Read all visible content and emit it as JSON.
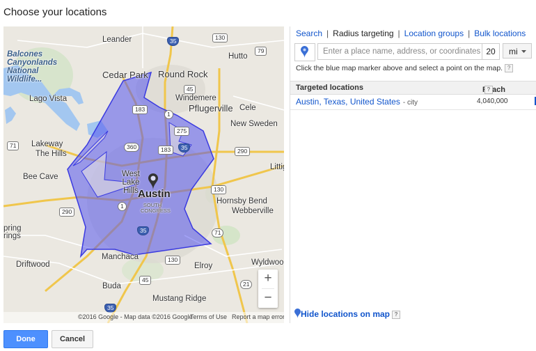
{
  "dialog": {
    "title": "Choose your locations"
  },
  "map": {
    "labels": {
      "leander": "Leander",
      "cedar_park": "Cedar Park",
      "round_rock": "Round Rock",
      "hutto": "Hutto",
      "balcones": "Balcones Canyonlands National Wildlife...",
      "lago_vista": "Lago Vista",
      "windemere": "Windemere",
      "pflugerville": "Pflugerville",
      "cele": "Cele",
      "new_sweden": "New Sweden",
      "lakeway": "Lakeway",
      "the_hills": "The Hills",
      "bee_cave": "Bee Cave",
      "west_lake_hills": "West Lake Hills",
      "austin": "Austin",
      "south_congress": "SOUTH CONGRESS",
      "littig": "Littig",
      "hornsby_bend": "Hornsby Bend",
      "webberville": "Webberville",
      "spring": "pring",
      "rings": "rings",
      "driftwood": "Driftwood",
      "manchaca": "Manchaca",
      "elroy": "Elroy",
      "wyldwood": "Wyldwood",
      "buda": "Buda",
      "mustang_ridge": "Mustang Ridge"
    },
    "shields": {
      "i35_north": "35",
      "us130_north": "130",
      "us79": "79",
      "us183_north": "183",
      "r1_north": "1",
      "us45_north": "45",
      "r275": "275",
      "us183_mid": "183",
      "i35_mid": "35",
      "r360": "360",
      "us290_east": "290",
      "r71_west": "71",
      "us290_west": "290",
      "r1_south": "1",
      "us130_mid": "130",
      "i35_south": "35",
      "r71_east": "71",
      "us45_south": "45",
      "r21": "21",
      "us130_south": "130",
      "i35_bottom": "35"
    },
    "zoom_in": "+",
    "zoom_out": "−",
    "footer": {
      "copyright": "©2016 Google - Map data ©2016 Google",
      "terms": "Terms of Use",
      "report": "Report a map error"
    },
    "selection_color": "#5555ee"
  },
  "panel": {
    "tabs": {
      "search": "Search",
      "radius": "Radius targeting",
      "groups": "Location groups",
      "bulk": "Bulk locations"
    },
    "separator": "|",
    "place_input": {
      "placeholder": "Enter a place name, address, or coordinates",
      "value": ""
    },
    "radius_value": "20",
    "unit": "mi",
    "hint": "Click the blue map marker above and select a point on the map.",
    "help_badge": "?",
    "table": {
      "col_targeted": "Targeted locations",
      "col_reach": "Reach",
      "rows": [
        {
          "name": "Austin, Texas, United States",
          "type": "- city",
          "reach": "4,040,000"
        }
      ]
    },
    "hide_locations": "Hide locations on map"
  },
  "buttons": {
    "done": "Done",
    "cancel": "Cancel"
  },
  "colors": {
    "link": "#1155cc",
    "primary": "#4d90fe",
    "marker": "#3a6fd6"
  }
}
